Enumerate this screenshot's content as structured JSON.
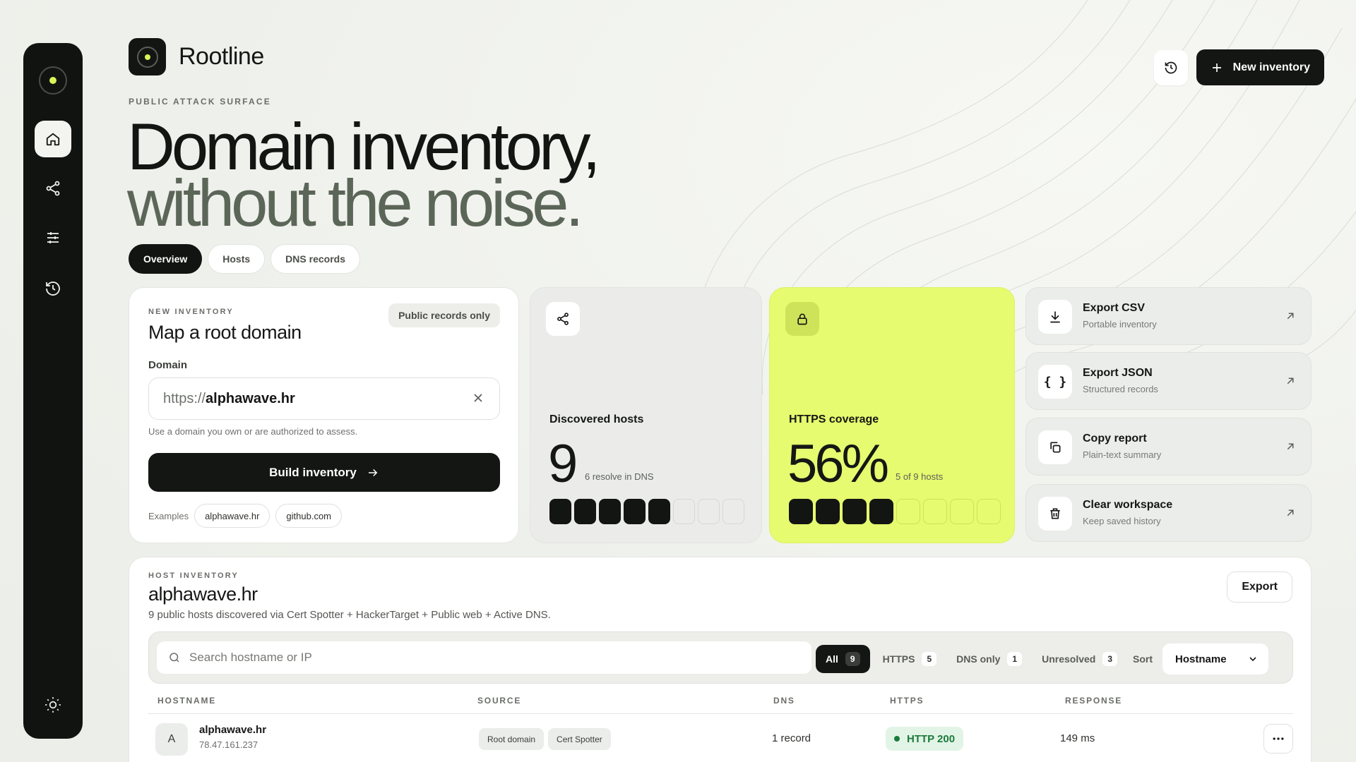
{
  "brand": {
    "name": "Rootline"
  },
  "header": {
    "new_inventory_label": "New inventory",
    "history_icon": "history-icon"
  },
  "hero": {
    "eyebrow": "PUBLIC ATTACK SURFACE",
    "line1": "Domain inventory,",
    "line2": "without the noise."
  },
  "tabs": [
    {
      "label": "Overview",
      "active": true
    },
    {
      "label": "Hosts",
      "active": false
    },
    {
      "label": "DNS records",
      "active": false
    }
  ],
  "new_inventory": {
    "eyebrow": "NEW INVENTORY",
    "title": "Map a root domain",
    "badge": "Public records only",
    "domain_label": "Domain",
    "domain_prefix": "https://",
    "domain_value": "alphawave.hr",
    "hint": "Use a domain you own or are authorized to assess.",
    "build_label": "Build inventory",
    "examples_label": "Examples",
    "examples": [
      "alphawave.hr",
      "github.com"
    ]
  },
  "discovered": {
    "label": "Discovered hosts",
    "value": "9",
    "sub": "6 resolve in DNS",
    "filled": 5,
    "total": 8
  },
  "https": {
    "label": "HTTPS coverage",
    "value": "56%",
    "sub": "5 of 9 hosts",
    "filled": 4,
    "total": 8,
    "accent": "#e6fb6f"
  },
  "actions": [
    {
      "title": "Export CSV",
      "sub": "Portable inventory",
      "icon": "download-icon"
    },
    {
      "title": "Export JSON",
      "sub": "Structured records",
      "icon": "braces-icon"
    },
    {
      "title": "Copy report",
      "sub": "Plain-text summary",
      "icon": "copy-icon"
    },
    {
      "title": "Clear workspace",
      "sub": "Keep saved history",
      "icon": "trash-icon"
    }
  ],
  "inventory": {
    "eyebrow": "HOST INVENTORY",
    "title": "alphawave.hr",
    "subtitle": "9 public hosts discovered via Cert Spotter + HackerTarget + Public web + Active DNS.",
    "export_label": "Export",
    "search_placeholder": "Search hostname or IP",
    "filters": [
      {
        "label": "All",
        "count": "9",
        "active": true
      },
      {
        "label": "HTTPS",
        "count": "5",
        "active": false
      },
      {
        "label": "DNS only",
        "count": "1",
        "active": false
      },
      {
        "label": "Unresolved",
        "count": "3",
        "active": false
      }
    ],
    "sort_label": "Sort",
    "sort_value": "Hostname",
    "columns": [
      "HOSTNAME",
      "SOURCE",
      "DNS",
      "HTTPS",
      "RESPONSE"
    ],
    "rows": [
      {
        "avatar": "A",
        "hostname": "alphawave.hr",
        "ip": "78.47.161.237",
        "sources": [
          "Root domain",
          "Cert Spotter"
        ],
        "dns": "1 record",
        "https": "HTTP 200",
        "response": "149 ms"
      }
    ]
  }
}
